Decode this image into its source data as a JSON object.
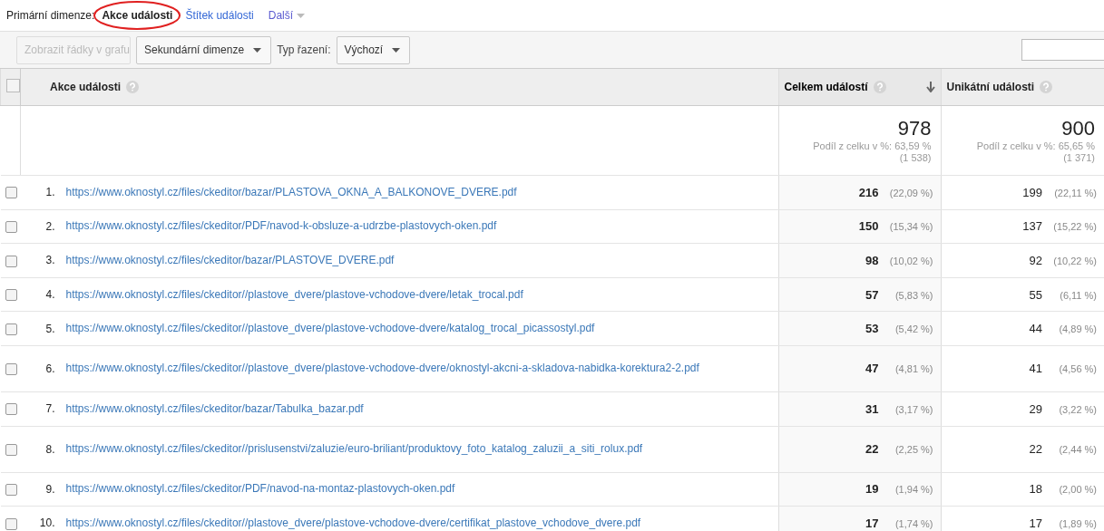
{
  "primary_dimension": {
    "label": "Primární dimenze:",
    "options": [
      {
        "label": "Akce události",
        "selected": true
      },
      {
        "label": "Štítek události",
        "selected": false
      }
    ],
    "more": "Další"
  },
  "toolbar": {
    "plot_button": {
      "label": "Zobrazit řádky v grafu",
      "disabled": true
    },
    "secondary_dimension": "Sekundární dimenze",
    "sort_label": "Typ řazení:",
    "sort_value": "Výchozí"
  },
  "table": {
    "header_checked": false,
    "columns": [
      {
        "label": "Akce události",
        "sorted": false
      },
      {
        "label": "Celkem událostí",
        "sorted": true
      },
      {
        "label": "Unikátní události",
        "sorted": false
      }
    ],
    "totals": [
      {
        "value": "978",
        "share": "Podíl z celku v %: 63,59 %",
        "total": "(1 538)"
      },
      {
        "value": "900",
        "share": "Podíl z celku v %: 65,65 %",
        "total": "(1 371)"
      }
    ],
    "rows": [
      {
        "index": "1.",
        "checked": false,
        "action": "https://www.oknostyl.cz/files/ckeditor/bazar/PLASTOVA_OKNA_A_BALKONOVE_DVERE.pdf",
        "total": "216",
        "total_pct": "(22,09 %)",
        "unique": "199",
        "unique_pct": "(22,11 %)"
      },
      {
        "index": "2.",
        "checked": false,
        "action": "https://www.oknostyl.cz/files/ckeditor/PDF/navod-k-obsluze-a-udrzbe-plastovych-oken.pdf",
        "total": "150",
        "total_pct": "(15,34 %)",
        "unique": "137",
        "unique_pct": "(15,22 %)"
      },
      {
        "index": "3.",
        "checked": false,
        "action": "https://www.oknostyl.cz/files/ckeditor/bazar/PLASTOVE_DVERE.pdf",
        "total": "98",
        "total_pct": "(10,02 %)",
        "unique": "92",
        "unique_pct": "(10,22 %)"
      },
      {
        "index": "4.",
        "checked": false,
        "action": "https://www.oknostyl.cz/files/ckeditor//plastove_dvere/plastove-vchodove-dvere/letak_trocal.pdf",
        "total": "57",
        "total_pct": "(5,83 %)",
        "unique": "55",
        "unique_pct": "(6,11 %)"
      },
      {
        "index": "5.",
        "checked": false,
        "action": "https://www.oknostyl.cz/files/ckeditor//plastove_dvere/plastove-vchodove-dvere/katalog_trocal_picassostyl.pdf",
        "total": "53",
        "total_pct": "(5,42 %)",
        "unique": "44",
        "unique_pct": "(4,89 %)"
      },
      {
        "index": "6.",
        "checked": false,
        "action": "https://www.oknostyl.cz/files/ckeditor//plastove_dvere/plastove-vchodove-dvere/oknostyl-akcni-a-skladova-nabidka-korektura2-2.pdf",
        "total": "47",
        "total_pct": "(4,81 %)",
        "unique": "41",
        "unique_pct": "(4,56 %)"
      },
      {
        "index": "7.",
        "checked": false,
        "action": "https://www.oknostyl.cz/files/ckeditor/bazar/Tabulka_bazar.pdf",
        "total": "31",
        "total_pct": "(3,17 %)",
        "unique": "29",
        "unique_pct": "(3,22 %)"
      },
      {
        "index": "8.",
        "checked": false,
        "action": "https://www.oknostyl.cz/files/ckeditor//prislusenstvi/zaluzie/euro-briliant/produktovy_foto_katalog_zaluzii_a_siti_rolux.pdf",
        "total": "22",
        "total_pct": "(2,25 %)",
        "unique": "22",
        "unique_pct": "(2,44 %)"
      },
      {
        "index": "9.",
        "checked": false,
        "action": "https://www.oknostyl.cz/files/ckeditor/PDF/navod-na-montaz-plastovych-oken.pdf",
        "total": "19",
        "total_pct": "(1,94 %)",
        "unique": "18",
        "unique_pct": "(2,00 %)"
      },
      {
        "index": "10.",
        "checked": false,
        "action": "https://www.oknostyl.cz/files/ckeditor//plastove_dvere/plastove-vchodove-dvere/certifikat_plastove_vchodove_dvere.pdf",
        "total": "17",
        "total_pct": "(1,74 %)",
        "unique": "17",
        "unique_pct": "(1,89 %)"
      }
    ]
  }
}
